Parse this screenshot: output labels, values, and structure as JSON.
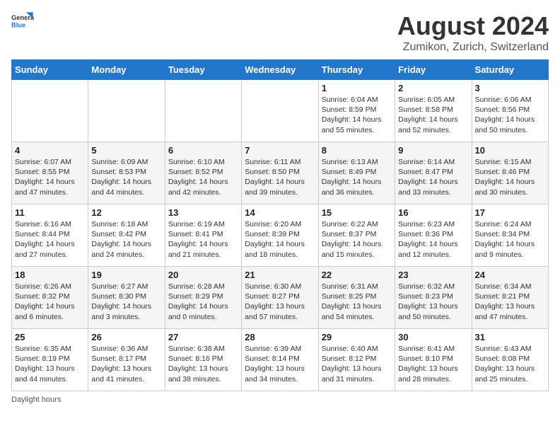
{
  "header": {
    "logo_general": "General",
    "logo_blue": "Blue",
    "title": "August 2024",
    "subtitle": "Zumikon, Zurich, Switzerland"
  },
  "days_of_week": [
    "Sunday",
    "Monday",
    "Tuesday",
    "Wednesday",
    "Thursday",
    "Friday",
    "Saturday"
  ],
  "weeks": [
    [
      {
        "day": "",
        "info": ""
      },
      {
        "day": "",
        "info": ""
      },
      {
        "day": "",
        "info": ""
      },
      {
        "day": "",
        "info": ""
      },
      {
        "day": "1",
        "info": "Sunrise: 6:04 AM\nSunset: 8:59 PM\nDaylight: 14 hours\nand 55 minutes."
      },
      {
        "day": "2",
        "info": "Sunrise: 6:05 AM\nSunset: 8:58 PM\nDaylight: 14 hours\nand 52 minutes."
      },
      {
        "day": "3",
        "info": "Sunrise: 6:06 AM\nSunset: 8:56 PM\nDaylight: 14 hours\nand 50 minutes."
      }
    ],
    [
      {
        "day": "4",
        "info": "Sunrise: 6:07 AM\nSunset: 8:55 PM\nDaylight: 14 hours\nand 47 minutes."
      },
      {
        "day": "5",
        "info": "Sunrise: 6:09 AM\nSunset: 8:53 PM\nDaylight: 14 hours\nand 44 minutes."
      },
      {
        "day": "6",
        "info": "Sunrise: 6:10 AM\nSunset: 8:52 PM\nDaylight: 14 hours\nand 42 minutes."
      },
      {
        "day": "7",
        "info": "Sunrise: 6:11 AM\nSunset: 8:50 PM\nDaylight: 14 hours\nand 39 minutes."
      },
      {
        "day": "8",
        "info": "Sunrise: 6:13 AM\nSunset: 8:49 PM\nDaylight: 14 hours\nand 36 minutes."
      },
      {
        "day": "9",
        "info": "Sunrise: 6:14 AM\nSunset: 8:47 PM\nDaylight: 14 hours\nand 33 minutes."
      },
      {
        "day": "10",
        "info": "Sunrise: 6:15 AM\nSunset: 8:46 PM\nDaylight: 14 hours\nand 30 minutes."
      }
    ],
    [
      {
        "day": "11",
        "info": "Sunrise: 6:16 AM\nSunset: 8:44 PM\nDaylight: 14 hours\nand 27 minutes."
      },
      {
        "day": "12",
        "info": "Sunrise: 6:18 AM\nSunset: 8:42 PM\nDaylight: 14 hours\nand 24 minutes."
      },
      {
        "day": "13",
        "info": "Sunrise: 6:19 AM\nSunset: 8:41 PM\nDaylight: 14 hours\nand 21 minutes."
      },
      {
        "day": "14",
        "info": "Sunrise: 6:20 AM\nSunset: 8:39 PM\nDaylight: 14 hours\nand 18 minutes."
      },
      {
        "day": "15",
        "info": "Sunrise: 6:22 AM\nSunset: 8:37 PM\nDaylight: 14 hours\nand 15 minutes."
      },
      {
        "day": "16",
        "info": "Sunrise: 6:23 AM\nSunset: 8:36 PM\nDaylight: 14 hours\nand 12 minutes."
      },
      {
        "day": "17",
        "info": "Sunrise: 6:24 AM\nSunset: 8:34 PM\nDaylight: 14 hours\nand 9 minutes."
      }
    ],
    [
      {
        "day": "18",
        "info": "Sunrise: 6:26 AM\nSunset: 8:32 PM\nDaylight: 14 hours\nand 6 minutes."
      },
      {
        "day": "19",
        "info": "Sunrise: 6:27 AM\nSunset: 8:30 PM\nDaylight: 14 hours\nand 3 minutes."
      },
      {
        "day": "20",
        "info": "Sunrise: 6:28 AM\nSunset: 8:29 PM\nDaylight: 14 hours\nand 0 minutes."
      },
      {
        "day": "21",
        "info": "Sunrise: 6:30 AM\nSunset: 8:27 PM\nDaylight: 13 hours\nand 57 minutes."
      },
      {
        "day": "22",
        "info": "Sunrise: 6:31 AM\nSunset: 8:25 PM\nDaylight: 13 hours\nand 54 minutes."
      },
      {
        "day": "23",
        "info": "Sunrise: 6:32 AM\nSunset: 8:23 PM\nDaylight: 13 hours\nand 50 minutes."
      },
      {
        "day": "24",
        "info": "Sunrise: 6:34 AM\nSunset: 8:21 PM\nDaylight: 13 hours\nand 47 minutes."
      }
    ],
    [
      {
        "day": "25",
        "info": "Sunrise: 6:35 AM\nSunset: 8:19 PM\nDaylight: 13 hours\nand 44 minutes."
      },
      {
        "day": "26",
        "info": "Sunrise: 6:36 AM\nSunset: 8:17 PM\nDaylight: 13 hours\nand 41 minutes."
      },
      {
        "day": "27",
        "info": "Sunrise: 6:38 AM\nSunset: 8:16 PM\nDaylight: 13 hours\nand 38 minutes."
      },
      {
        "day": "28",
        "info": "Sunrise: 6:39 AM\nSunset: 8:14 PM\nDaylight: 13 hours\nand 34 minutes."
      },
      {
        "day": "29",
        "info": "Sunrise: 6:40 AM\nSunset: 8:12 PM\nDaylight: 13 hours\nand 31 minutes."
      },
      {
        "day": "30",
        "info": "Sunrise: 6:41 AM\nSunset: 8:10 PM\nDaylight: 13 hours\nand 28 minutes."
      },
      {
        "day": "31",
        "info": "Sunrise: 6:43 AM\nSunset: 8:08 PM\nDaylight: 13 hours\nand 25 minutes."
      }
    ]
  ],
  "footer": {
    "note": "Daylight hours"
  },
  "colors": {
    "header_bg": "#2277cc",
    "header_text": "#ffffff",
    "accent": "#2277cc"
  }
}
